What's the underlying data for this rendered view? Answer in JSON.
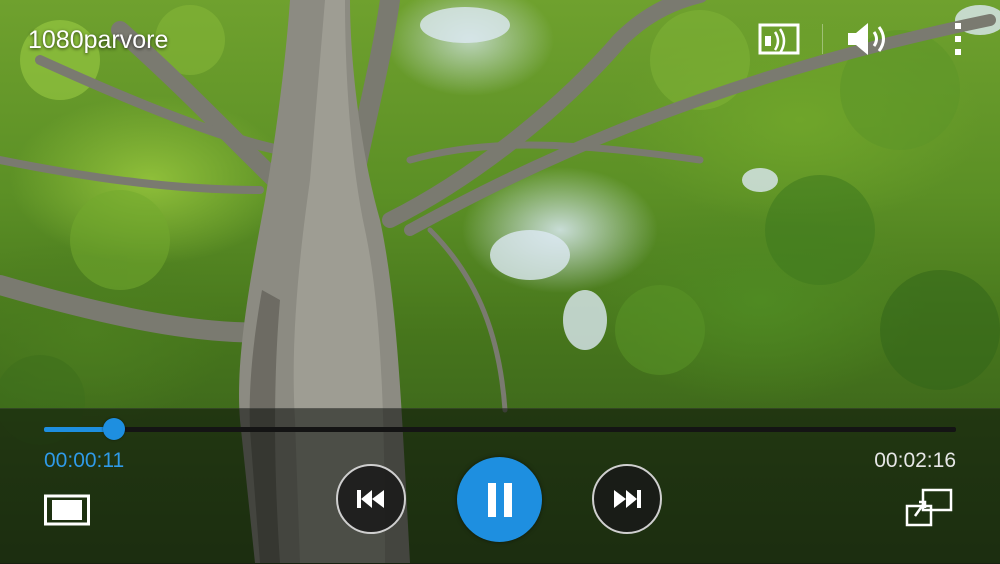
{
  "video": {
    "title": "1080parvore",
    "content": "tree-canopy-frame"
  },
  "top_bar": {
    "icons": [
      "screen-mirroring-icon",
      "volume-icon",
      "more-options-icon"
    ]
  },
  "player": {
    "current_time": "00:00:11",
    "total_time": "00:02:16",
    "progress": 0.077,
    "state": "playing"
  },
  "controls": {
    "icons": [
      "aspect-ratio-icon",
      "rewind-icon",
      "pause-icon",
      "fast-forward-icon",
      "popup-player-icon"
    ]
  },
  "colors": {
    "accent": "#1e8fe0",
    "current_time": "#2f9ae8",
    "total_time": "#e6e6e6"
  }
}
